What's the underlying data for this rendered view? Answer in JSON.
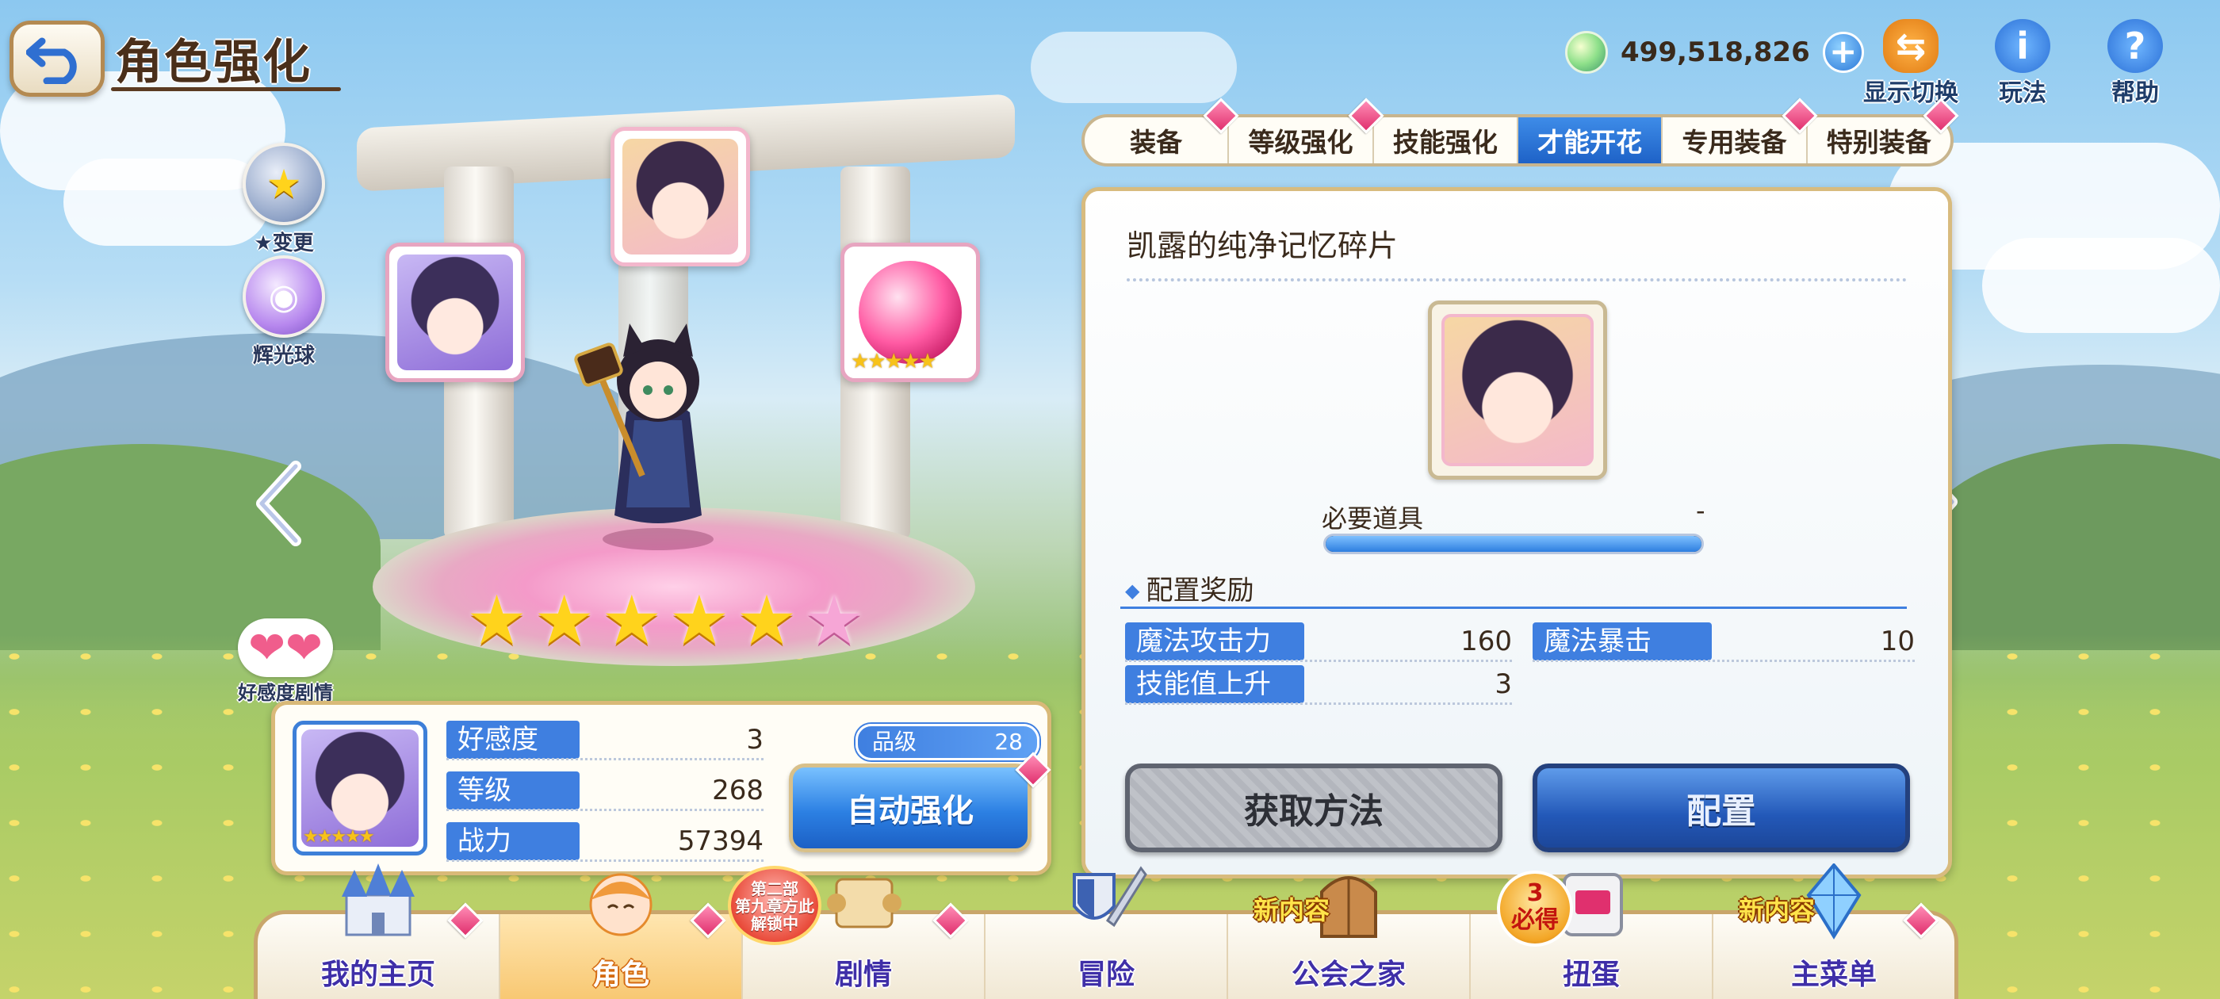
{
  "header": {
    "title": "角色强化",
    "currency_value": "499,518,826",
    "icons": [
      {
        "name": "display-toggle-icon",
        "label": "显示切换"
      },
      {
        "name": "how-to-play-icon",
        "label": "玩法"
      },
      {
        "name": "help-icon",
        "label": "帮助"
      }
    ]
  },
  "side": {
    "star_change_label": "★变更",
    "glow_orb_label": "辉光球",
    "affection_story_label": "好感度剧情"
  },
  "stars": {
    "filled": 5,
    "total": 6
  },
  "portrait_stars": "★★★★★",
  "info": {
    "affection_label": "好感度",
    "affection_value": "3",
    "level_label": "等级",
    "level_value": "268",
    "power_label": "战力",
    "power_value": "57394",
    "rank_label": "品级",
    "rank_value": "28",
    "auto_enhance_label": "自动强化"
  },
  "tabs": [
    {
      "label": "装备",
      "active": false,
      "badge": true
    },
    {
      "label": "等级强化",
      "active": false,
      "badge": true
    },
    {
      "label": "技能强化",
      "active": false,
      "badge": false
    },
    {
      "label": "才能开花",
      "active": true,
      "badge": false
    },
    {
      "label": "专用装备",
      "active": false,
      "badge": true
    },
    {
      "label": "特别装备",
      "active": false,
      "badge": true
    }
  ],
  "panel": {
    "item_title": "凯露的纯净记忆碎片",
    "required_label": "必要道具",
    "required_value": "-",
    "required_progress": 1.0,
    "reward_title": "配置奖励",
    "bonuses": [
      {
        "label": "魔法攻击力",
        "value": "160"
      },
      {
        "label": "魔法暴击",
        "value": "10"
      },
      {
        "label": "技能值上升",
        "value": "3"
      }
    ],
    "get_method_label": "获取方法",
    "configure_label": "配置"
  },
  "nav": {
    "items": [
      {
        "label": "我的主页",
        "active": false
      },
      {
        "label": "角色",
        "active": true
      },
      {
        "label": "剧情",
        "active": false
      },
      {
        "label": "冒险",
        "active": false
      },
      {
        "label": "公会之家",
        "active": false
      },
      {
        "label": "扭蛋",
        "active": false
      },
      {
        "label": "主菜单",
        "active": false
      }
    ],
    "chapter_badge": [
      "第二部",
      "第九章方此",
      "解锁中"
    ],
    "guild_new_label": "新内容",
    "menu_new_label": "新内容",
    "gacha_badge": [
      "3",
      "必得"
    ]
  },
  "colors": {
    "accent_blue": "#3f7fe0",
    "panel_border": "#d8bb7e",
    "badge_pink": "#e0306e",
    "active_nav": "#f8c873"
  }
}
